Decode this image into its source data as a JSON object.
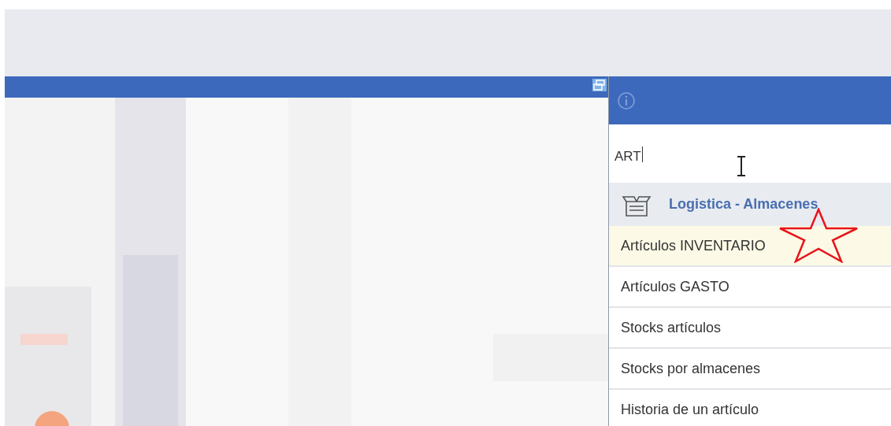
{
  "search": {
    "value": "ART"
  },
  "group": {
    "title": "Logistica - Almacenes"
  },
  "results": [
    {
      "label": "Artículos INVENTARIO",
      "selected": true
    },
    {
      "label": "Artículos GASTO",
      "selected": false
    },
    {
      "label": "Stocks artículos",
      "selected": false
    },
    {
      "label": "Stocks por almacenes",
      "selected": false
    },
    {
      "label": "Historia de un artículo",
      "selected": false
    }
  ]
}
